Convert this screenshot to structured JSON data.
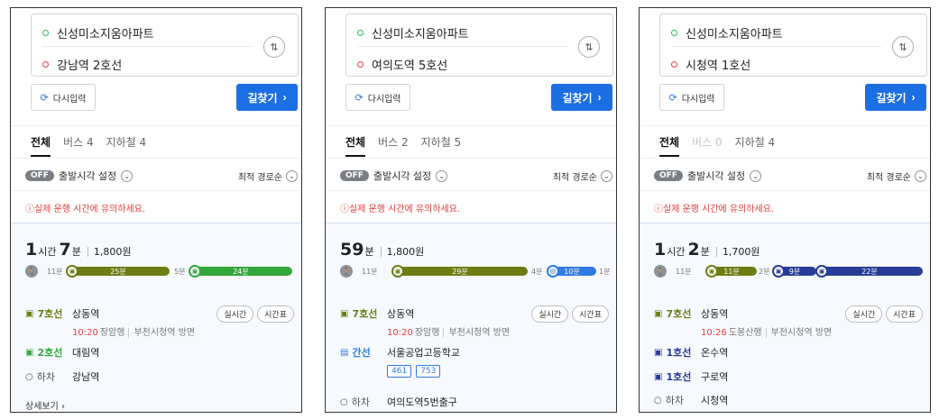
{
  "panels": [
    {
      "start": "신성미소지움아파트",
      "end": "강남역 2호선",
      "reset_label": "다시입력",
      "find_label": "길찾기",
      "tabs": [
        "전체",
        "버스 4",
        "지하철 4"
      ],
      "off_label": "OFF",
      "depart_label": "출발시각 설정",
      "sort_label": "최적 경로순",
      "warning": "실제 운행 시간에 유의하세요.",
      "duration": {
        "h": "1",
        "h_unit": "시간",
        "m": "7",
        "m_unit": "분"
      },
      "fare": "1,800원",
      "bar": {
        "walk1": "11분",
        "seg1": "25분",
        "walk2": "5분",
        "seg2": "24분"
      },
      "steps": [
        {
          "line": "7호선",
          "station": "상동역",
          "time": "10:20",
          "dir1": "장암행",
          "dir2": "부천시청역 방면",
          "realtime": "실시간",
          "timetable": "시간표"
        },
        {
          "line": "2호선",
          "station": "대림역"
        },
        {
          "line": "하차",
          "station": "강남역"
        }
      ],
      "more": "상세보기"
    },
    {
      "start": "신성미소지움아파트",
      "end": "여의도역 5호선",
      "reset_label": "다시입력",
      "find_label": "길찾기",
      "tabs": [
        "전체",
        "버스 2",
        "지하철 5"
      ],
      "off_label": "OFF",
      "depart_label": "출발시각 설정",
      "sort_label": "최적 경로순",
      "warning": "실제 운행 시간에 유의하세요.",
      "duration": {
        "m": "59",
        "m_unit": "분"
      },
      "fare": "1,800원",
      "bar": {
        "walk1": "11분",
        "seg1": "29분",
        "walk2": "4분",
        "seg2": "10분",
        "walk3": "1분"
      },
      "steps": [
        {
          "line": "7호선",
          "station": "상동역",
          "time": "10:20",
          "dir1": "장암행",
          "dir2": "부천시청역 방면",
          "realtime": "실시간",
          "timetable": "시간표"
        },
        {
          "line": "간선",
          "station": "서울공업고등학교",
          "buses": [
            "461",
            "753"
          ]
        },
        {
          "line": "하차",
          "station": "여의도역5번출구"
        }
      ]
    },
    {
      "start": "신성미소지움아파트",
      "end": "시청역 1호선",
      "reset_label": "다시입력",
      "find_label": "길찾기",
      "tabs": [
        "전체",
        "버스 0",
        "지하철 4"
      ],
      "off_label": "OFF",
      "depart_label": "출발시각 설정",
      "sort_label": "최적 경로순",
      "warning": "실제 운행 시간에 유의하세요.",
      "duration": {
        "h": "1",
        "h_unit": "시간",
        "m": "2",
        "m_unit": "분"
      },
      "fare": "1,700원",
      "bar": {
        "walk1": "11분",
        "seg1": "11분",
        "walk2": "2분",
        "seg2": "9분",
        "seg3": "22분"
      },
      "steps": [
        {
          "line": "7호선",
          "station": "상동역",
          "time": "10:26",
          "dir1": "도봉산행",
          "dir2": "부천시청역 방면",
          "realtime": "실시간",
          "timetable": "시간표"
        },
        {
          "line": "1호선",
          "station": "온수역"
        },
        {
          "line": "1호선",
          "station": "구로역"
        },
        {
          "line": "하차",
          "station": "시청역"
        }
      ]
    }
  ],
  "colors": {
    "line7": "#6e7d13",
    "line2": "#33a63c",
    "line1": "#263c96",
    "bus_trunk": "#2f7be0",
    "accent": "#1c6fe2",
    "warning": "#e33b3b"
  }
}
